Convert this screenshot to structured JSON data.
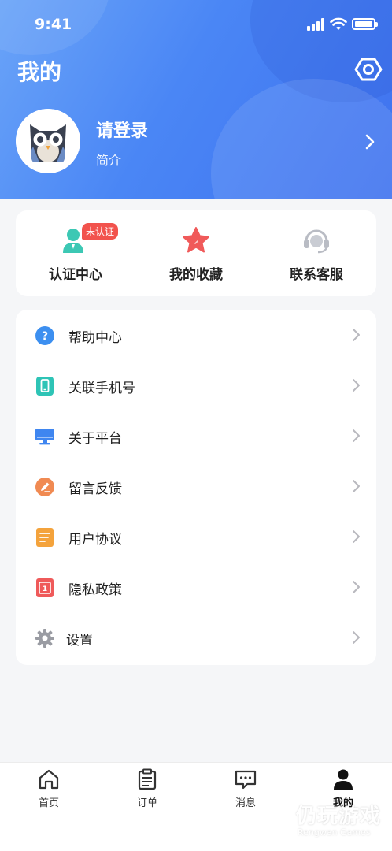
{
  "status_bar": {
    "time": "9:41"
  },
  "header": {
    "title": "我的",
    "settings_icon": "settings-hexagon-icon",
    "profile": {
      "name": "请登录",
      "bio": "简介",
      "avatar_icon": "owl-avatar-icon"
    }
  },
  "quick_actions": [
    {
      "label": "认证中心",
      "badge": "未认证",
      "icon": "certification-user-icon",
      "color": "#3cc8b4"
    },
    {
      "label": "我的收藏",
      "icon": "star-icon",
      "color": "#f05a5a"
    },
    {
      "label": "联系客服",
      "icon": "headset-icon",
      "color": "#b9bcc4"
    }
  ],
  "menu": [
    {
      "label": "帮助中心",
      "icon": "help-icon",
      "color": "#3c8ff0"
    },
    {
      "label": "关联手机号",
      "icon": "phone-icon",
      "color": "#2ec4b6"
    },
    {
      "label": "关于平台",
      "icon": "monitor-icon",
      "color": "#3f86f0"
    },
    {
      "label": "留言反馈",
      "icon": "feedback-pen-icon",
      "color": "#f08a52"
    },
    {
      "label": "用户协议",
      "icon": "agreement-doc-icon",
      "color": "#f4a33c"
    },
    {
      "label": "隐私政策",
      "icon": "privacy-doc-icon",
      "color": "#ef5a5a"
    },
    {
      "label": "设置",
      "icon": "gear-icon",
      "color": "#9a9ca3"
    }
  ],
  "tabbar": [
    {
      "label": "首页",
      "icon": "home-icon",
      "active": false
    },
    {
      "label": "订单",
      "icon": "clipboard-icon",
      "active": false
    },
    {
      "label": "消息",
      "icon": "chat-icon",
      "active": false
    },
    {
      "label": "我的",
      "icon": "person-icon",
      "active": true
    }
  ],
  "watermark": {
    "text": "仍玩游戏",
    "subtext": "Rengwan Games"
  }
}
